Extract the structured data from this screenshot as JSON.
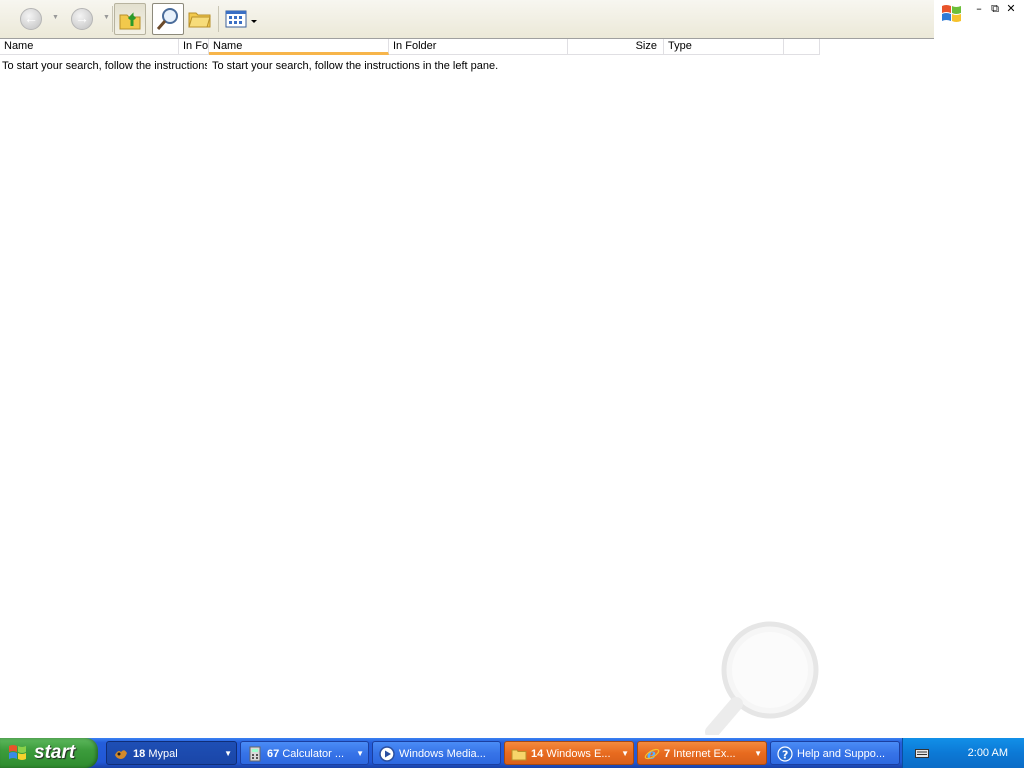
{
  "toolbar": {
    "buttons": [
      {
        "name": "back-button",
        "icon": "arrow-left-icon"
      },
      {
        "name": "forward-button",
        "icon": "arrow-right-icon"
      },
      {
        "name": "up-button",
        "icon": "folder-up-icon"
      },
      {
        "name": "search-button",
        "icon": "magnifier-icon"
      },
      {
        "name": "folders-button",
        "icon": "folders-icon"
      },
      {
        "name": "views-button",
        "icon": "views-icon"
      }
    ]
  },
  "panes": {
    "left": {
      "columns": [
        "Name",
        "In Fo"
      ],
      "message": "To start your search, follow the instructions in the left pane."
    },
    "main": {
      "columns": [
        "Name",
        "In Folder",
        "Size",
        "Type"
      ],
      "message": "To start your search, follow the instructions in the left pane."
    }
  },
  "taskbar": {
    "start_label": "start",
    "tasks": [
      {
        "count": "18",
        "label": "Mypal",
        "icon": "mypal-icon",
        "state": "active"
      },
      {
        "count": "67",
        "label": "Calculator ...",
        "icon": "calculator-icon",
        "state": "normal"
      },
      {
        "count": "",
        "label": "Windows Media...",
        "icon": "media-player-icon",
        "state": "normal"
      },
      {
        "count": "14",
        "label": "Windows E...",
        "icon": "folder-icon",
        "state": "flash"
      },
      {
        "count": "7",
        "label": "Internet Ex...",
        "icon": "ie-icon",
        "state": "flash"
      },
      {
        "count": "",
        "label": "Help and Suppo...",
        "icon": "help-icon",
        "state": "normal"
      }
    ],
    "clock": "2:00 AM"
  },
  "colors": {
    "taskbar_blue": "#245edb",
    "start_green": "#3c9c3c",
    "flash_orange": "#e86b1f",
    "sort_underline": "#f7b54a"
  }
}
